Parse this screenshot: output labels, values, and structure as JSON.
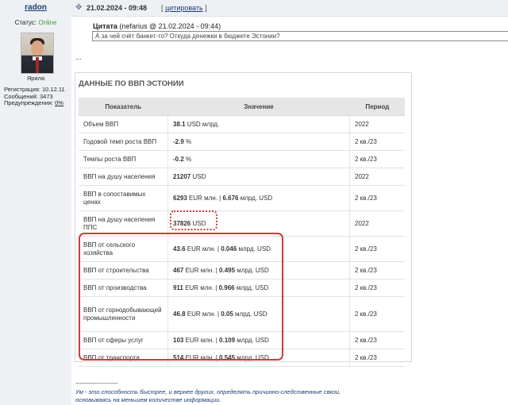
{
  "user": {
    "name": "radon",
    "status_label": "Статус:",
    "status_value": "Online",
    "avatar_caption": "Ярила",
    "registration": "Регистрация: 10.12.11",
    "messages": "Сообщений: 3473",
    "warnings_label": "Предупреждения: ",
    "warnings_value": "0%"
  },
  "post": {
    "date": "21.02.2024 - 09:48",
    "quote_open": "[",
    "quote_action": "цитировать",
    "quote_close": "]",
    "quote_title": "Цитата",
    "quote_meta": " (nefarius @ 21.02.2024 - 09:44)",
    "quote_text": "А за чей счёт банкет-то? Откуда денежки в бюджете Эстонии?",
    "ellipsis": "..."
  },
  "card": {
    "title": "ДАННЫЕ ПО ВВП ЭСТОНИИ",
    "headers": {
      "name": "Показатель",
      "value": "Значение",
      "period": "Период"
    },
    "rows": [
      {
        "name": "Объем ВВП",
        "v1": "38.1",
        "u1": " USD млрд.",
        "sep": "",
        "v2": "",
        "u2": "",
        "period": "2022",
        "h": 22
      },
      {
        "name": "Годовой темп роста ВВП",
        "v1": "-2.9",
        "u1": " %",
        "sep": "",
        "v2": "",
        "u2": "",
        "period": "2 кв./23",
        "h": 22
      },
      {
        "name": "Темпы роста ВВП",
        "v1": "-0.2",
        "u1": " %",
        "sep": "",
        "v2": "",
        "u2": "",
        "period": "2 кв./23",
        "h": 22
      },
      {
        "name": "ВВП на душу населения",
        "v1": "21207",
        "u1": " USD",
        "sep": "",
        "v2": "",
        "u2": "",
        "period": "2022",
        "h": 22
      },
      {
        "name": "ВВП в сопоставимых ценах",
        "v1": "6293",
        "u1": " EUR млн. | ",
        "sep": "",
        "v2": "6.676",
        "u2": " млрд. USD",
        "period": "2 кв./23",
        "h": 32
      },
      {
        "name": "ВВП на душу населения ППС",
        "v1": "37826",
        "u1": " USD",
        "sep": "",
        "v2": "",
        "u2": "",
        "period": "2022",
        "h": 32
      },
      {
        "name": "ВВП от сельского хозяйства",
        "v1": "43.6",
        "u1": " EUR млн. | ",
        "sep": "",
        "v2": "0.046",
        "u2": " млрд. USD",
        "period": "2 кв./23",
        "h": 32
      },
      {
        "name": "ВВП от строительства",
        "v1": "467",
        "u1": " EUR млн. | ",
        "sep": "",
        "v2": "0.495",
        "u2": " млрд. USD",
        "period": "2 кв./23",
        "h": 22
      },
      {
        "name": "ВВП от производства",
        "v1": "911",
        "u1": " EUR млн. | ",
        "sep": "",
        "v2": "0.966",
        "u2": " млрд. USD",
        "period": "2 кв./23",
        "h": 22
      },
      {
        "name": "ВВП от горнодобывающей промышленности",
        "v1": "46.8",
        "u1": " EUR млн. | ",
        "sep": "",
        "v2": "0.05",
        "u2": " млрд. USD",
        "period": "2 кв./23",
        "h": 44
      },
      {
        "name": "ВВП от сферы услуг",
        "v1": "103",
        "u1": " EUR млн. | ",
        "sep": "",
        "v2": "0.109",
        "u2": " млрд. USD",
        "period": "2 кв./23",
        "h": 22
      },
      {
        "name": "ВВП от транспорта",
        "v1": "514",
        "u1": " EUR млн. | ",
        "sep": "",
        "v2": "0.545",
        "u2": " млрд. USD",
        "period": "2 кв./23",
        "h": 22
      }
    ]
  },
  "signature": {
    "separator": "--------------------",
    "line1": "Ум - это способность быстрее, и вернее других, определять причинно-следственные связи,",
    "line2": "основываясь на меньшем количестве информации."
  },
  "icons": {
    "post": "pin-icon"
  },
  "colors": {
    "highlight": "#d23a3a",
    "link": "#1b3a73",
    "online": "#3aa028"
  }
}
